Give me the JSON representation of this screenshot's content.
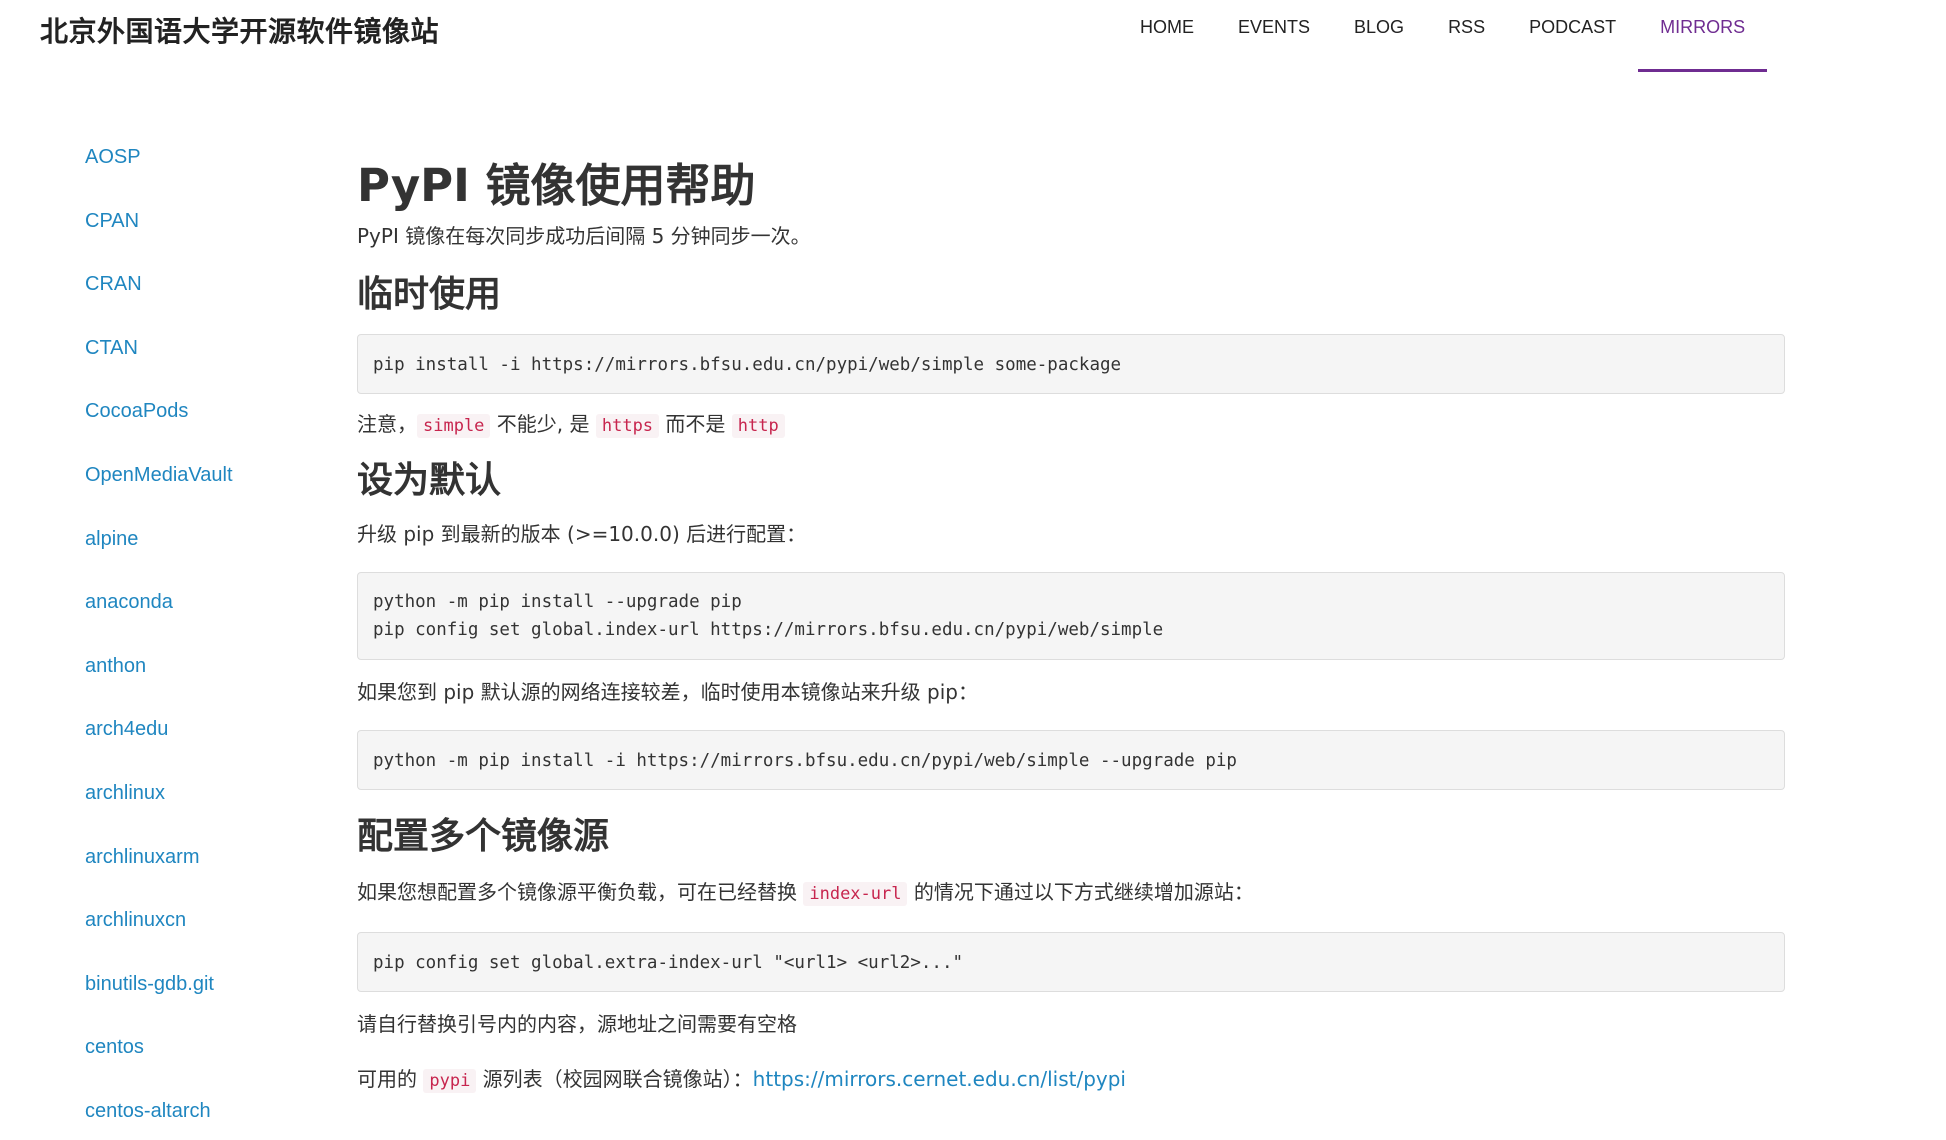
{
  "site": {
    "title": "北京外国语大学开源软件镜像站"
  },
  "nav": {
    "items": [
      {
        "label": "HOME"
      },
      {
        "label": "EVENTS"
      },
      {
        "label": "BLOG"
      },
      {
        "label": "RSS"
      },
      {
        "label": "PODCAST"
      },
      {
        "label": "MIRRORS"
      }
    ],
    "active": "MIRRORS"
  },
  "sidebar": {
    "items": [
      {
        "label": "AOSP"
      },
      {
        "label": "CPAN"
      },
      {
        "label": "CRAN"
      },
      {
        "label": "CTAN"
      },
      {
        "label": "CocoaPods"
      },
      {
        "label": "OpenMediaVault"
      },
      {
        "label": "alpine"
      },
      {
        "label": "anaconda"
      },
      {
        "label": "anthon"
      },
      {
        "label": "arch4edu"
      },
      {
        "label": "archlinux"
      },
      {
        "label": "archlinuxarm"
      },
      {
        "label": "archlinuxcn"
      },
      {
        "label": "binutils-gdb.git"
      },
      {
        "label": "centos"
      },
      {
        "label": "centos-altarch"
      }
    ]
  },
  "content": {
    "title": "PyPI 镜像使用帮助",
    "intro": "PyPI 镜像在每次同步成功后间隔 5 分钟同步一次。",
    "temp_use": {
      "heading": "临时使用",
      "code": "pip install -i https://mirrors.bfsu.edu.cn/pypi/web/simple some-package",
      "note": {
        "text1": "注意，",
        "code1": "simple",
        "text2": " 不能少, 是 ",
        "code2": "https",
        "text3": " 而不是 ",
        "code3": "http"
      }
    },
    "default": {
      "heading": "设为默认",
      "text": "升级 pip 到最新的版本 (>=10.0.0) 后进行配置：",
      "code_line1": "python -m pip install --upgrade pip",
      "code_line2": "pip config set global.index-url https://mirrors.bfsu.edu.cn/pypi/web/simple",
      "text2": "如果您到 pip 默认源的网络连接较差，临时使用本镜像站来升级 pip：",
      "code2": "python -m pip install -i https://mirrors.bfsu.edu.cn/pypi/web/simple --upgrade pip"
    },
    "multi": {
      "heading": "配置多个镜像源",
      "text1": "如果您想配置多个镜像源平衡负载，可在已经替换 ",
      "code1": "index-url",
      "text2": " 的情况下通过以下方式继续增加源站：",
      "code": "pip config set global.extra-index-url \"<url1> <url2>...\"",
      "note": "请自行替换引号内的内容，源地址之间需要有空格",
      "avail_text1": "可用的 ",
      "avail_code": "pypi",
      "avail_text2": " 源列表（校园网联合镜像站）：",
      "avail_link": "https://mirrors.cernet.edu.cn/list/pypi"
    }
  }
}
